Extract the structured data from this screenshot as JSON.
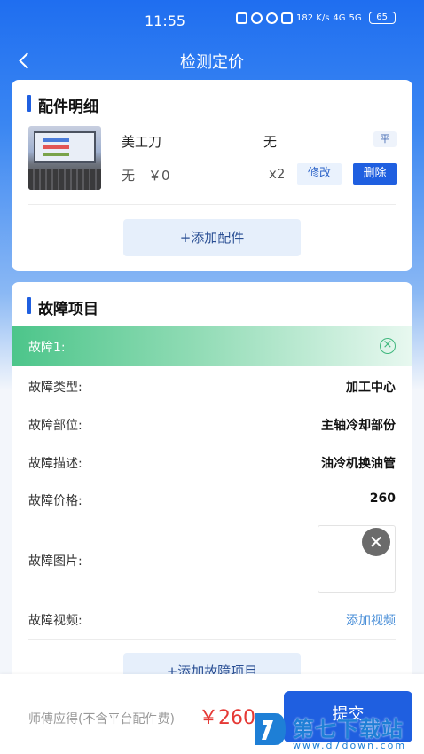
{
  "status_bar": {
    "time": "11:55",
    "net_speed": "182 K/s",
    "signal_1": "4G",
    "signal_2": "5G",
    "battery": "65"
  },
  "nav": {
    "title": "检测定价",
    "back_icon": "chevron-left-icon"
  },
  "parts_section": {
    "title": "配件明细",
    "items": [
      {
        "name": "美工刀",
        "spec": "无",
        "badge": "平",
        "brand": "无",
        "price": "￥0",
        "qty": "x2",
        "edit_label": "修改",
        "delete_label": "删除"
      }
    ],
    "add_label": "+添加配件"
  },
  "faults_section": {
    "title": "故障项目",
    "faults": [
      {
        "header": "故障1:",
        "type_label": "故障类型:",
        "type_value": "加工中心",
        "location_label": "故障部位:",
        "location_value": "主轴冷却部份",
        "desc_label": "故障描述:",
        "desc_value": "油冷机换油管",
        "price_label": "故障价格:",
        "price_value": "260",
        "image_label": "故障图片:",
        "video_label": "故障视频:",
        "add_video_label": "添加视频"
      }
    ],
    "add_label": "+添加故障项目"
  },
  "footer": {
    "earn_label": "师傅应得(不含平台配件费)",
    "earn_amount": "￥260",
    "submit_label": "提交"
  },
  "watermark": {
    "text": "第七下载站",
    "url": "www.d7down.com"
  },
  "colors": {
    "primary": "#1f5fe0",
    "fault_header": "#4cc58a",
    "price_red": "#e53935",
    "link_blue": "#4a8fd8"
  }
}
